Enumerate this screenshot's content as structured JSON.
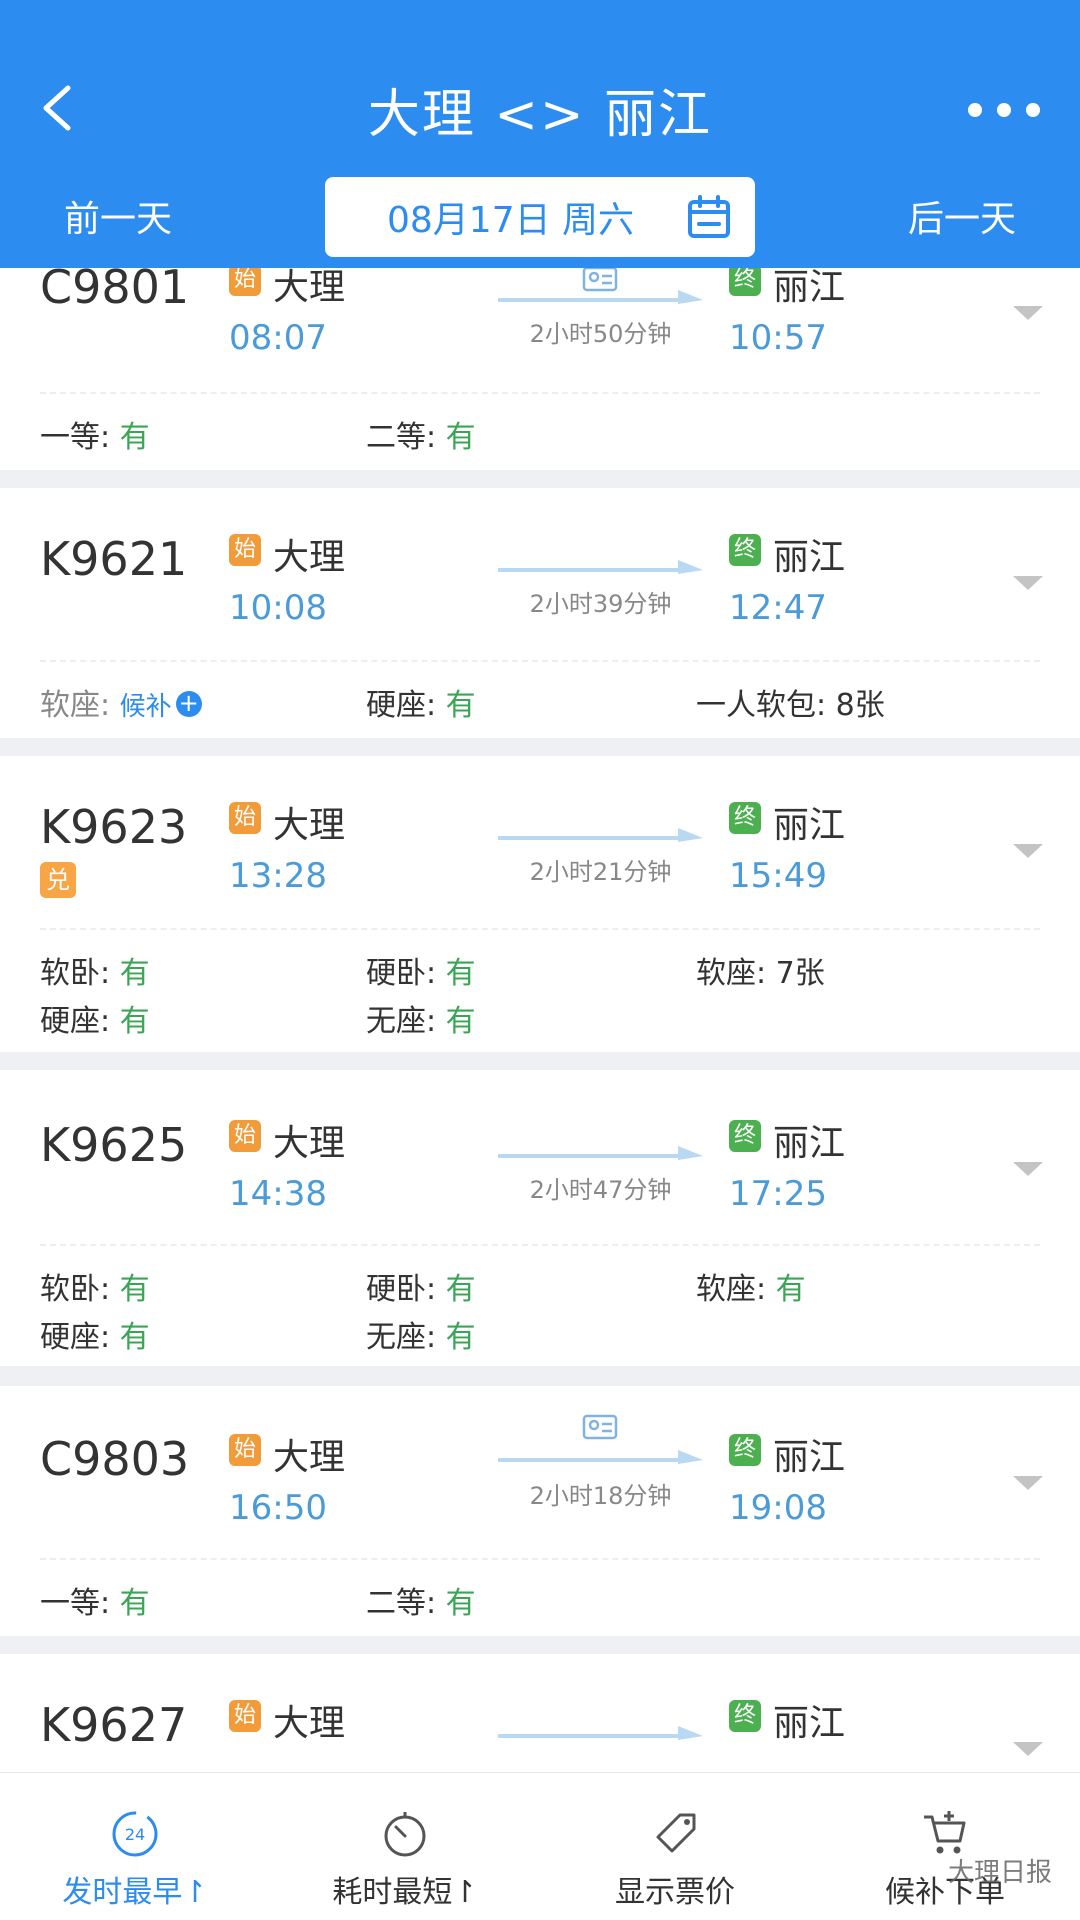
{
  "header": {
    "title": "大理 <> 丽江",
    "prev_day": "前一天",
    "next_day": "后一天",
    "date": "08月17日 周六"
  },
  "badges": {
    "start": "始",
    "end": "终",
    "dui": "兑"
  },
  "trains": [
    {
      "no": "C9801",
      "from": "大理",
      "dep": "08:07",
      "duration": "2小时50分钟",
      "to": "丽江",
      "arr": "10:57",
      "seats": [
        {
          "label": "一等:",
          "value": "有"
        },
        {
          "label": "二等:",
          "value": "有"
        }
      ]
    },
    {
      "no": "K9621",
      "from": "大理",
      "dep": "10:08",
      "duration": "2小时39分钟",
      "to": "丽江",
      "arr": "12:47",
      "seats": [
        {
          "label": "软座:",
          "value": "候补"
        },
        {
          "label": "硬座:",
          "value": "有"
        },
        {
          "label": "一人软包:",
          "value": "8张"
        }
      ]
    },
    {
      "no": "K9623",
      "from": "大理",
      "dep": "13:28",
      "duration": "2小时21分钟",
      "to": "丽江",
      "arr": "15:49",
      "seats": [
        {
          "label": "软卧:",
          "value": "有"
        },
        {
          "label": "硬卧:",
          "value": "有"
        },
        {
          "label": "软座:",
          "value": "7张"
        },
        {
          "label": "硬座:",
          "value": "有"
        },
        {
          "label": "无座:",
          "value": "有"
        }
      ]
    },
    {
      "no": "K9625",
      "from": "大理",
      "dep": "14:38",
      "duration": "2小时47分钟",
      "to": "丽江",
      "arr": "17:25",
      "seats": [
        {
          "label": "软卧:",
          "value": "有"
        },
        {
          "label": "硬卧:",
          "value": "有"
        },
        {
          "label": "软座:",
          "value": "有"
        },
        {
          "label": "硬座:",
          "value": "有"
        },
        {
          "label": "无座:",
          "value": "有"
        }
      ]
    },
    {
      "no": "C9803",
      "from": "大理",
      "dep": "16:50",
      "duration": "2小时18分钟",
      "to": "丽江",
      "arr": "19:08",
      "seats": [
        {
          "label": "一等:",
          "value": "有"
        },
        {
          "label": "二等:",
          "value": "有"
        }
      ]
    },
    {
      "no": "K9627",
      "from": "大理",
      "to": "丽江"
    }
  ],
  "bottom_tabs": [
    {
      "label": "发时最早↾",
      "icon": "clock-24-icon",
      "icon_text": "24"
    },
    {
      "label": "耗时最短↾",
      "icon": "stopwatch-icon"
    },
    {
      "label": "显示票价",
      "icon": "price-tag-icon"
    },
    {
      "label": "候补下单",
      "icon": "cart-icon"
    }
  ],
  "watermark": "大理日报",
  "colors": {
    "primary": "#2d8cf0",
    "available": "#3aa655",
    "time": "#4a9bd8",
    "start_badge": "#f29b3a",
    "end_badge": "#4caf50"
  }
}
